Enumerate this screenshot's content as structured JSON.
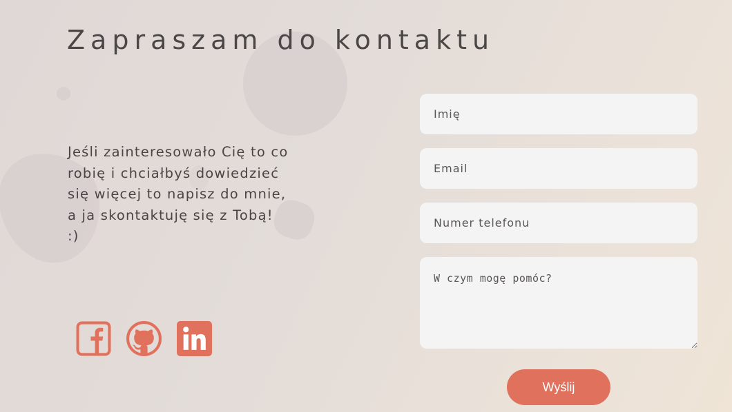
{
  "contact": {
    "title": "Zapraszam do kontaktu",
    "intro": "Jeśli zainteresowało Cię to co robię i chciałbyś dowiedzieć się więcej to napisz do mnie, a ja skontaktuję się z Tobą! :)"
  },
  "socials": [
    {
      "icon": "facebook-icon"
    },
    {
      "icon": "github-icon"
    },
    {
      "icon": "linkedin-icon"
    }
  ],
  "form": {
    "name_placeholder": "Imię",
    "email_placeholder": "Email",
    "phone_placeholder": "Numer telefonu",
    "message_placeholder": "W czym mogę pomóc?",
    "submit_label": "Wyślij"
  },
  "colors": {
    "accent": "#e0715c",
    "field_bg": "#f4f4f4",
    "text": "#4a4545"
  }
}
